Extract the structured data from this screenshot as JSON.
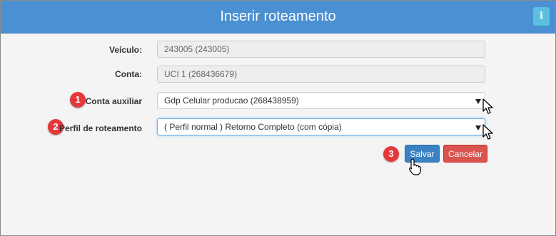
{
  "dialog": {
    "title": "Inserir roteamento",
    "info_icon": "i"
  },
  "form": {
    "veiculo": {
      "label": "Veículo:",
      "value": "243005 (243005)"
    },
    "conta": {
      "label": "Conta:",
      "value": "UCI 1 (268436679)"
    },
    "conta_auxiliar": {
      "label": "Conta auxiliar",
      "value": "Gdp Celular producao (268438959)"
    },
    "perfil_roteamento": {
      "label": "Perfil de roteamento",
      "value": "( Perfil normal ) Retorno Completo (com cópia)"
    }
  },
  "buttons": {
    "save": "Salvar",
    "cancel": "Cancelar"
  },
  "steps": [
    "1",
    "2",
    "3"
  ],
  "colors": {
    "header": "#4a90d2",
    "info": "#5bc0de",
    "save": "#3b82c4",
    "cancel": "#d9534f",
    "badge": "#e5383b"
  }
}
